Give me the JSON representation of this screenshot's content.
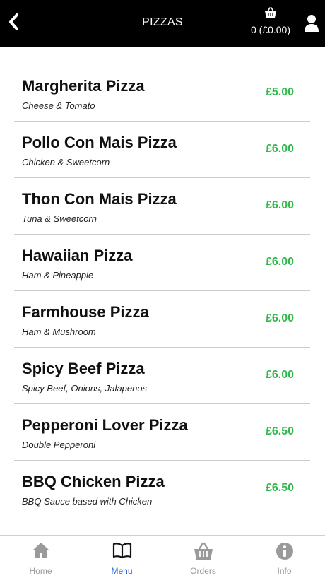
{
  "header": {
    "title": "PIZZAS",
    "cart_summary": "0 (£0.00)",
    "back_icon": "chevron-left-icon",
    "basket_icon": "basket-icon",
    "account_icon": "user-icon"
  },
  "menu": {
    "items": [
      {
        "name": "Margherita Pizza",
        "description": "Cheese & Tomato",
        "price": "£5.00"
      },
      {
        "name": "Pollo Con Mais Pizza",
        "description": "Chicken & Sweetcorn",
        "price": "£6.00"
      },
      {
        "name": "Thon Con Mais Pizza",
        "description": "Tuna & Sweetcorn",
        "price": "£6.00"
      },
      {
        "name": "Hawaiian Pizza",
        "description": "Ham & Pineapple",
        "price": "£6.00"
      },
      {
        "name": "Farmhouse Pizza",
        "description": "Ham & Mushroom",
        "price": "£6.00"
      },
      {
        "name": "Spicy Beef Pizza",
        "description": "Spicy Beef, Onions, Jalapenos",
        "price": "£6.00"
      },
      {
        "name": "Pepperoni Lover Pizza",
        "description": "Double Pepperoni",
        "price": "£6.50"
      },
      {
        "name": "BBQ Chicken Pizza",
        "description": "BBQ Sauce based with Chicken",
        "price": "£6.50"
      }
    ]
  },
  "tabbar": {
    "tabs": [
      {
        "label": "Home",
        "icon": "home-icon",
        "active": false
      },
      {
        "label": "Menu",
        "icon": "book-icon",
        "active": true
      },
      {
        "label": "Orders",
        "icon": "basket-icon",
        "active": false
      },
      {
        "label": "Info",
        "icon": "info-icon",
        "active": false
      }
    ]
  },
  "colors": {
    "header_bg": "#000000",
    "price": "#2fb94c",
    "tab_active": "#2f66cc",
    "tab_inactive": "#9a9a9a"
  }
}
